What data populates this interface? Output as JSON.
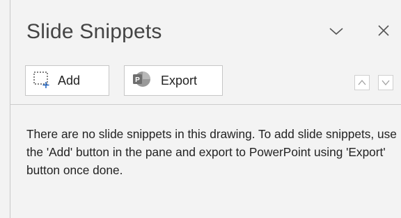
{
  "pane": {
    "title": "Slide Snippets",
    "dropdown_icon": "chevron-down-icon",
    "close_icon": "close-icon"
  },
  "toolbar": {
    "add_label": "Add",
    "add_icon": "add-snippet-icon",
    "export_label": "Export",
    "export_icon": "powerpoint-icon",
    "up_icon": "chevron-up-icon",
    "down_icon": "chevron-down-icon"
  },
  "message": "There are no slide snippets in this drawing. To add slide snippets, use the 'Add' button in the pane and export to PowerPoint using 'Export' button once done.",
  "colors": {
    "pane_background": "#f3f3f3",
    "accent_blue": "#2b6cc4",
    "powerpoint_red": "#c94a2c",
    "text": "#222222"
  }
}
